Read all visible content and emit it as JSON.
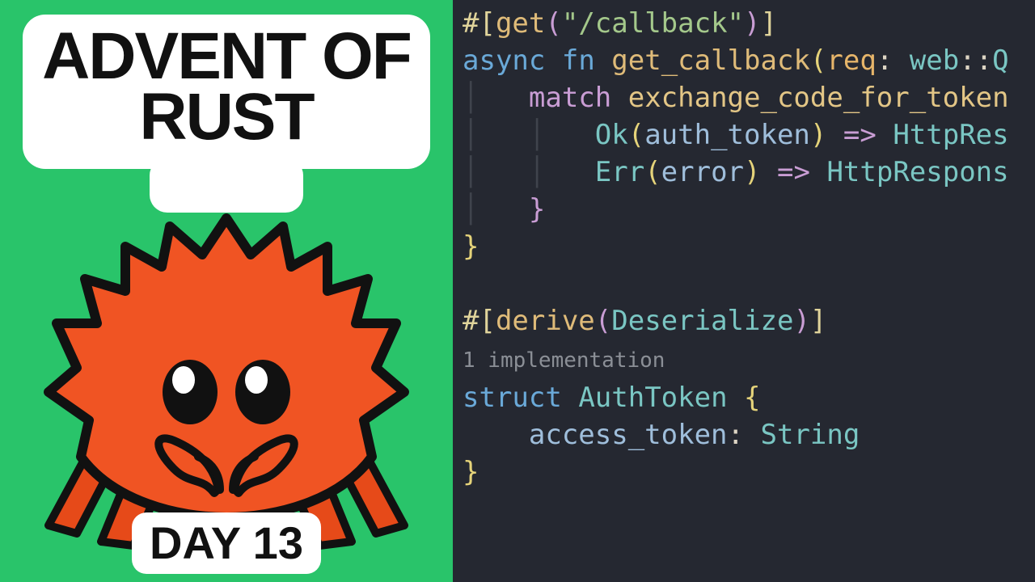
{
  "left": {
    "title_line1": "ADVENT OF",
    "title_line2": "RUST",
    "day": "DAY 13"
  },
  "code": {
    "l1": {
      "hash": "#[",
      "get": "get",
      "op": "(",
      "str": "\"/callback\"",
      "cp": ")",
      "end": "]"
    },
    "l2": {
      "async": "async",
      "fn": "fn",
      "name": "get_callback",
      "op": "(",
      "req": "req",
      "col": ":",
      "web": "web",
      "sep": "::",
      "q": "Q"
    },
    "l3": {
      "match": "match",
      "call": "exchange_code_for_token"
    },
    "l4": {
      "ok": "Ok",
      "op": "(",
      "var": "auth_token",
      "cp": ")",
      "arrow": "=>",
      "res": "HttpRes"
    },
    "l5": {
      "err": "Err",
      "op": "(",
      "var": "error",
      "cp": ")",
      "arrow": "=>",
      "res": "HttpRespons"
    },
    "l6": {
      "brace": "}"
    },
    "l7": {
      "brace": "}"
    },
    "l8": {
      "hash": "#[",
      "derive": "derive",
      "op": "(",
      "trait": "Deserialize",
      "cp": ")",
      "end": "]"
    },
    "l9": {
      "hint": "1 implementation"
    },
    "l10": {
      "struct": "struct",
      "name": "AuthToken",
      "brace": "{"
    },
    "l11": {
      "field": "access_token",
      "col": ":",
      "type": "String"
    },
    "l12": {
      "brace": "}"
    }
  }
}
